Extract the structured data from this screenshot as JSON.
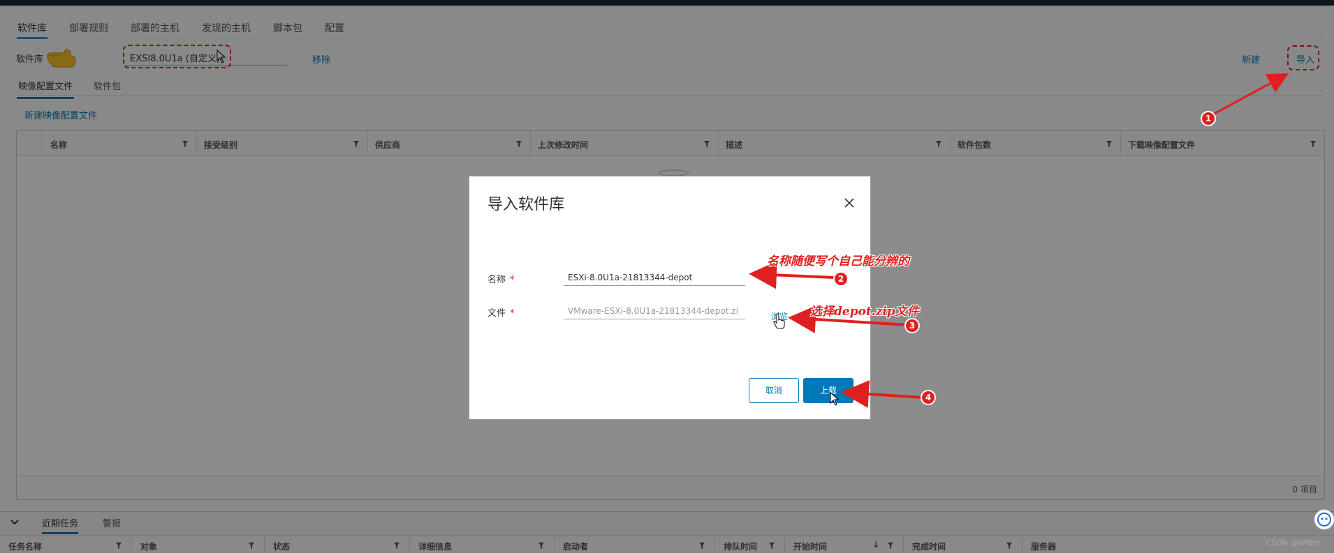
{
  "main_tabs": [
    "软件库",
    "部署规则",
    "部署的主机",
    "发现的主机",
    "脚本包",
    "配置"
  ],
  "depot": {
    "label": "软件库",
    "selected": "EXSI8.0U1a (自定义)",
    "remove_link": "移除",
    "new_link": "新建",
    "import_link": "导入"
  },
  "sub_tabs": [
    "映像配置文件",
    "软件包"
  ],
  "new_profile_link": "新建映像配置文件",
  "grid": {
    "columns": [
      "名称",
      "接受级别",
      "供应商",
      "上次修改时间",
      "描述",
      "软件包数",
      "下载映像配置文件"
    ],
    "footer": "0 项目"
  },
  "modal": {
    "title": "导入软件库",
    "name_label": "名称",
    "name_value": "ESXi-8.0U1a-21813344-depot",
    "file_label": "文件",
    "file_value": "VMware-ESXi-8.0U1a-21813344-depot.zi",
    "browse": "浏览",
    "cancel": "取消",
    "upload": "上载"
  },
  "annotations": {
    "note_name": "名称随便写个自己能分辨的",
    "note_file": "选择depot.zip文件",
    "steps": [
      "1",
      "2",
      "3",
      "4"
    ]
  },
  "bottom": {
    "tabs": [
      "近期任务",
      "警报"
    ],
    "columns": [
      "任务名称",
      "对象",
      "状态",
      "详细信息",
      "启动者",
      "排队时间",
      "开始时间",
      "完成时间",
      "服务器"
    ],
    "sort_indicator": "↓"
  },
  "watermark": "CSDN @Wifite",
  "colors": {
    "accent": "#0079b8",
    "annotation": "#e02020",
    "topbar": "#1d2b38"
  }
}
